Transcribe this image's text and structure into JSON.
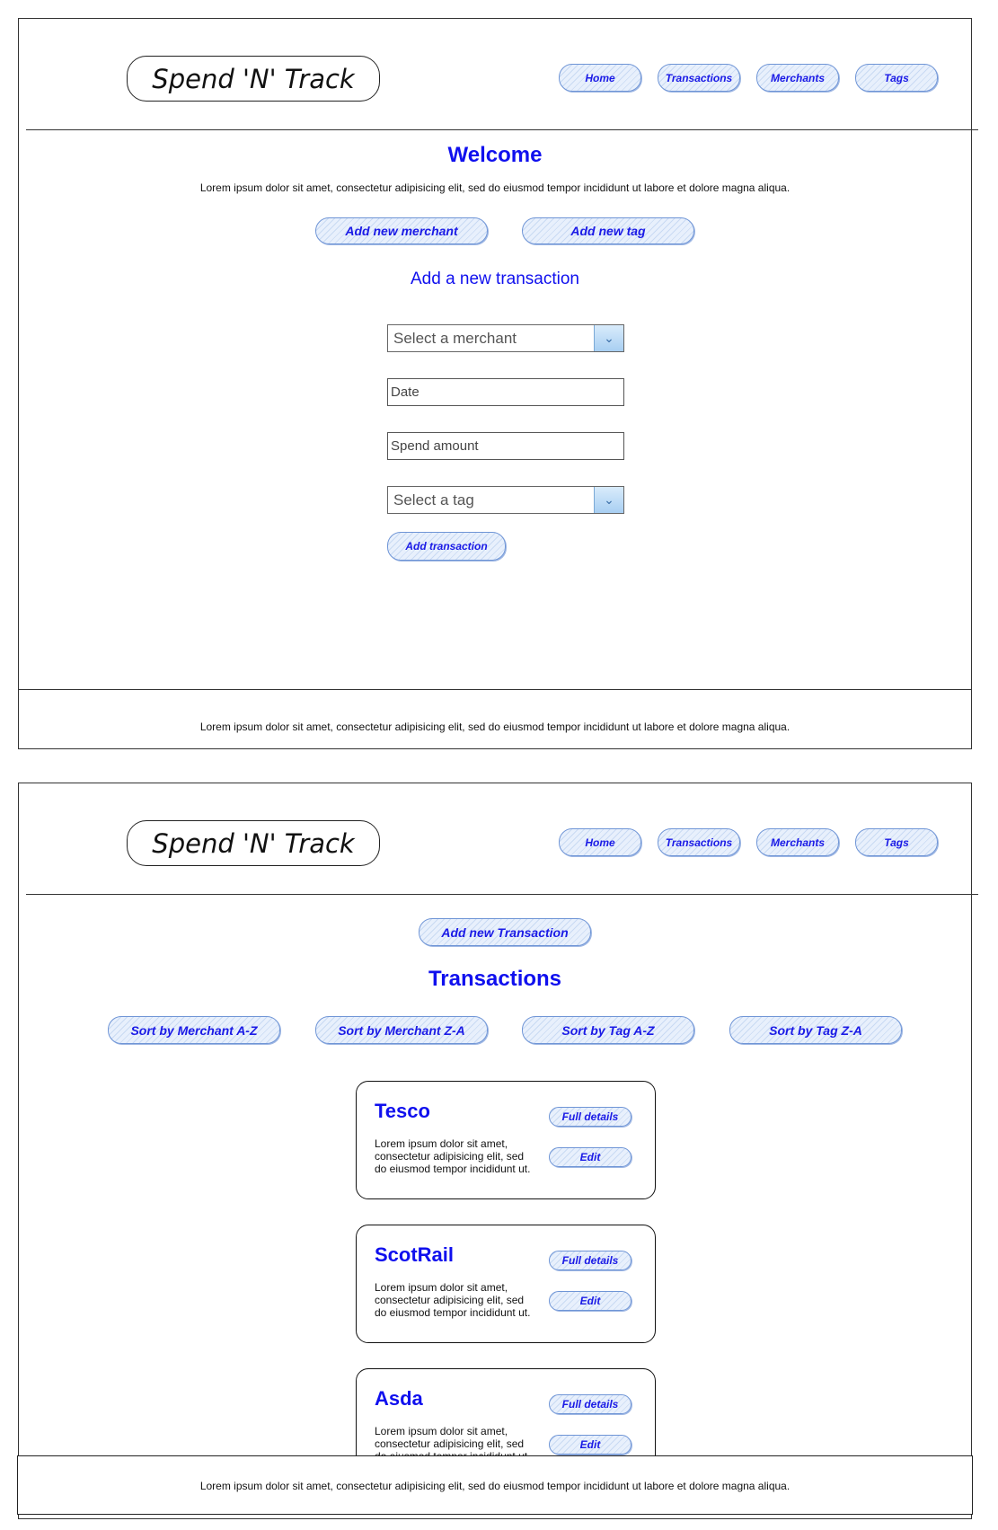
{
  "app": {
    "title": "Spend 'N' Track"
  },
  "nav": {
    "home": "Home",
    "transactions": "Transactions",
    "merchants": "Merchants",
    "tags": "Tags"
  },
  "lorem": "Lorem ipsum dolor sit amet, consectetur adipisicing elit, sed do eiusmod tempor incididunt ut labore et dolore magna aliqua.",
  "home": {
    "welcome": "Welcome",
    "add_merchant": "Add new merchant",
    "add_tag": "Add new tag",
    "form_title": "Add a new transaction",
    "merchant_select": "Select a merchant",
    "date_placeholder": "Date",
    "amount_placeholder": "Spend amount",
    "tag_select": "Select a tag",
    "submit": "Add transaction"
  },
  "transactions": {
    "add_button": "Add new Transaction",
    "title": "Transactions",
    "sort_merchant_az": "Sort by Merchant A-Z",
    "sort_merchant_za": "Sort by Merchant Z-A",
    "sort_tag_az": "Sort by Tag A-Z",
    "sort_tag_za": "Sort by Tag Z-A",
    "cards": [
      {
        "name": "Tesco",
        "text": "Lorem ipsum dolor sit amet, consectetur adipisicing elit, sed do eiusmod tempor incididunt ut."
      },
      {
        "name": "ScotRail",
        "text": "Lorem ipsum dolor sit amet, consectetur adipisicing elit, sed do eiusmod tempor incididunt ut."
      },
      {
        "name": "Asda",
        "text": "Lorem ipsum dolor sit amet, consectetur adipisicing elit, sed do eiusmod tempor incididunt ut."
      }
    ],
    "full_details": "Full details",
    "edit": "Edit"
  },
  "footer": {
    "text": "Lorem ipsum dolor sit amet, consectetur adipisicing elit, sed do eiusmod tempor incididunt ut labore et dolore magna aliqua."
  },
  "colors": {
    "accent": "#1010ee",
    "button_border": "#6f95d6"
  },
  "icons": {
    "dropdown": "chevron-down-icon"
  }
}
